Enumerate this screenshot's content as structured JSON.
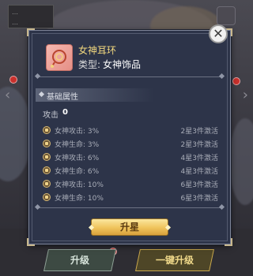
{
  "background": {
    "tag_lines": [
      "…",
      "…"
    ]
  },
  "dialog": {
    "item_name": "女神耳环",
    "type_label": "类型:",
    "type_value": "女神饰品",
    "section_title": "基础属性",
    "attack_label": "攻击",
    "attack_value": "0",
    "attributes": [
      {
        "text": "女神攻击: 3%",
        "condition": "2星3件激活"
      },
      {
        "text": "女神生命: 3%",
        "condition": "2星3件激活"
      },
      {
        "text": "女神攻击: 6%",
        "condition": "4星3件激活"
      },
      {
        "text": "女神生命: 6%",
        "condition": "4星3件激活"
      },
      {
        "text": "女神攻击: 10%",
        "condition": "6星3件激活"
      },
      {
        "text": "女神生命: 10%",
        "condition": "6星3件激活"
      }
    ],
    "upstar_label": "升星",
    "close_icon": "close-icon"
  },
  "bottom_bar": {
    "upgrade_label": "升级",
    "one_click_label": "一键升级"
  },
  "colors": {
    "dialog_bg": "#2d3449",
    "item_name": "#f3d97f",
    "upstar_button": "#efc35b"
  }
}
